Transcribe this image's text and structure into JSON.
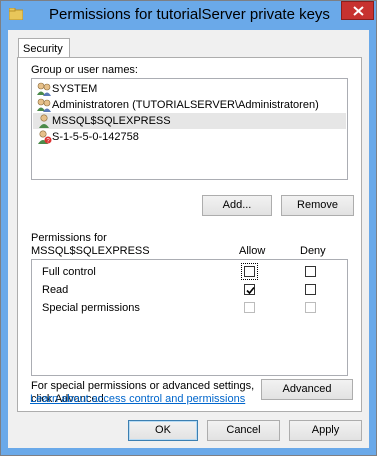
{
  "window": {
    "title": "Permissions for tutorialServer private keys",
    "close_icon": "close-icon",
    "title_icon": "folder-icon"
  },
  "tabs": [
    {
      "label": "Security",
      "selected": true
    }
  ],
  "users": {
    "header": "Group or user names:",
    "items": [
      {
        "label": "SYSTEM",
        "icon": "users-group-icon",
        "selected": false
      },
      {
        "label": "Administratoren (TUTORIALSERVER\\Administratoren)",
        "icon": "users-group-icon",
        "selected": false
      },
      {
        "label": "MSSQL$SQLEXPRESS",
        "icon": "user-icon",
        "selected": true
      },
      {
        "label": "S-1-5-5-0-142758",
        "icon": "unknown-user-icon",
        "selected": false
      }
    ]
  },
  "buttons": {
    "add": "Add...",
    "remove": "Remove",
    "advanced": "Advanced",
    "ok": "OK",
    "cancel": "Cancel",
    "apply": "Apply"
  },
  "permissions": {
    "header_line1": "Permissions for",
    "header_line2": "MSSQL$SQLEXPRESS",
    "allow_label": "Allow",
    "deny_label": "Deny",
    "rows": [
      {
        "name": "Full control",
        "allow": false,
        "deny": false,
        "disabled": false
      },
      {
        "name": "Read",
        "allow": true,
        "deny": false,
        "disabled": false
      },
      {
        "name": "Special permissions",
        "allow": false,
        "deny": false,
        "disabled": true
      }
    ]
  },
  "advanced_text": {
    "line1": "For special permissions or advanced settings,",
    "line2": "click Advanced."
  },
  "link": "Learn about access control and permissions",
  "colors": {
    "titlebar": "#6aa9e9",
    "close": "#c7322f",
    "link": "#0066cc"
  }
}
